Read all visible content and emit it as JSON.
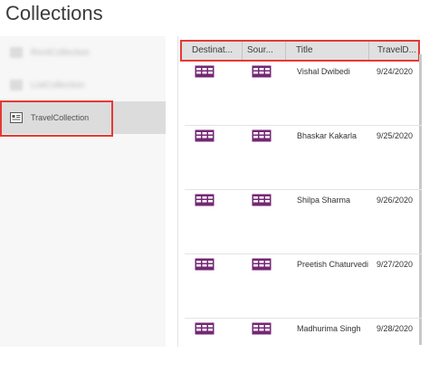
{
  "app": {
    "title": "Collections"
  },
  "sidebar": {
    "items": [
      {
        "label": "RentCollection",
        "state": "blurred"
      },
      {
        "label": "ListCollection",
        "state": "blurred"
      },
      {
        "label": "TravelCollection",
        "state": "selected"
      }
    ]
  },
  "grid": {
    "columns": [
      "Destinat...",
      "Sour...",
      "Title",
      "TravelD..."
    ],
    "rows": [
      {
        "destination_icon": "table-icon",
        "source_icon": "table-icon",
        "title": "Vishal Dwibedi",
        "date": "9/24/2020"
      },
      {
        "destination_icon": "table-icon",
        "source_icon": "table-icon",
        "title": "Bhaskar Kakarla",
        "date": "9/25/2020"
      },
      {
        "destination_icon": "table-icon",
        "source_icon": "table-icon",
        "title": "Shilpa Sharma",
        "date": "9/26/2020"
      },
      {
        "destination_icon": "table-icon",
        "source_icon": "table-icon",
        "title": "Preetish Chaturvedi",
        "date": "9/27/2020"
      },
      {
        "destination_icon": "table-icon",
        "source_icon": "table-icon",
        "title": "Madhurima Singh",
        "date": "9/28/2020"
      }
    ]
  },
  "colors": {
    "accent_icon": "#742774",
    "highlight": "#e53935",
    "selected_bg": "#dcdcdc",
    "header_bg": "#e0e0e0"
  }
}
